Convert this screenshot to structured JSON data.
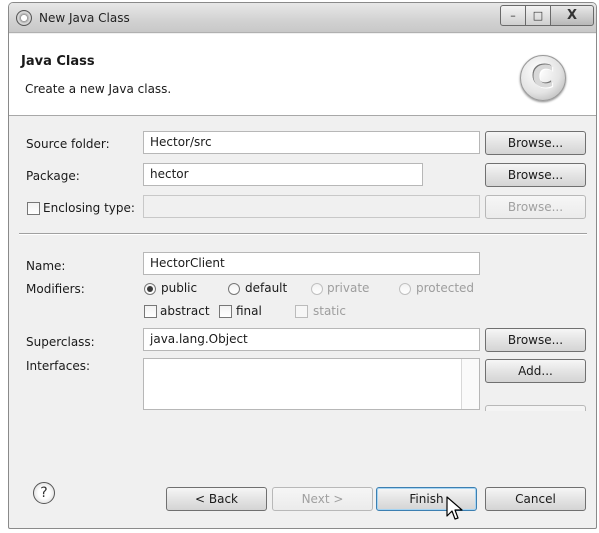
{
  "window": {
    "title": "New Java Class",
    "controls": {
      "minimize": "–",
      "maximize": "□",
      "close": "X"
    }
  },
  "banner": {
    "title": "Java Class",
    "description": "Create a new Java class.",
    "icon": "C"
  },
  "form": {
    "source_folder": {
      "label": "Source folder:",
      "value": "Hector/src",
      "button": "Browse..."
    },
    "package": {
      "label": "Package:",
      "value": "hector",
      "button": "Browse..."
    },
    "enclosing_type": {
      "label": "Enclosing type:",
      "value": "",
      "button": "Browse...",
      "checked": false
    },
    "name": {
      "label": "Name:",
      "value": "HectorClient"
    },
    "modifiers": {
      "label": "Modifiers:",
      "access": [
        {
          "label": "public",
          "selected": true,
          "enabled": true
        },
        {
          "label": "default",
          "selected": false,
          "enabled": true
        },
        {
          "label": "private",
          "selected": false,
          "enabled": false
        },
        {
          "label": "protected",
          "selected": false,
          "enabled": false
        }
      ],
      "flags": [
        {
          "label": "abstract",
          "checked": false,
          "enabled": true
        },
        {
          "label": "final",
          "checked": false,
          "enabled": true
        },
        {
          "label": "static",
          "checked": false,
          "enabled": false
        }
      ]
    },
    "superclass": {
      "label": "Superclass:",
      "value": "java.lang.Object",
      "button": "Browse..."
    },
    "interfaces": {
      "label": "Interfaces:",
      "button": "Add..."
    }
  },
  "footer": {
    "help": "?",
    "back": "< Back",
    "next": "Next >",
    "finish": "Finish",
    "cancel": "Cancel"
  }
}
